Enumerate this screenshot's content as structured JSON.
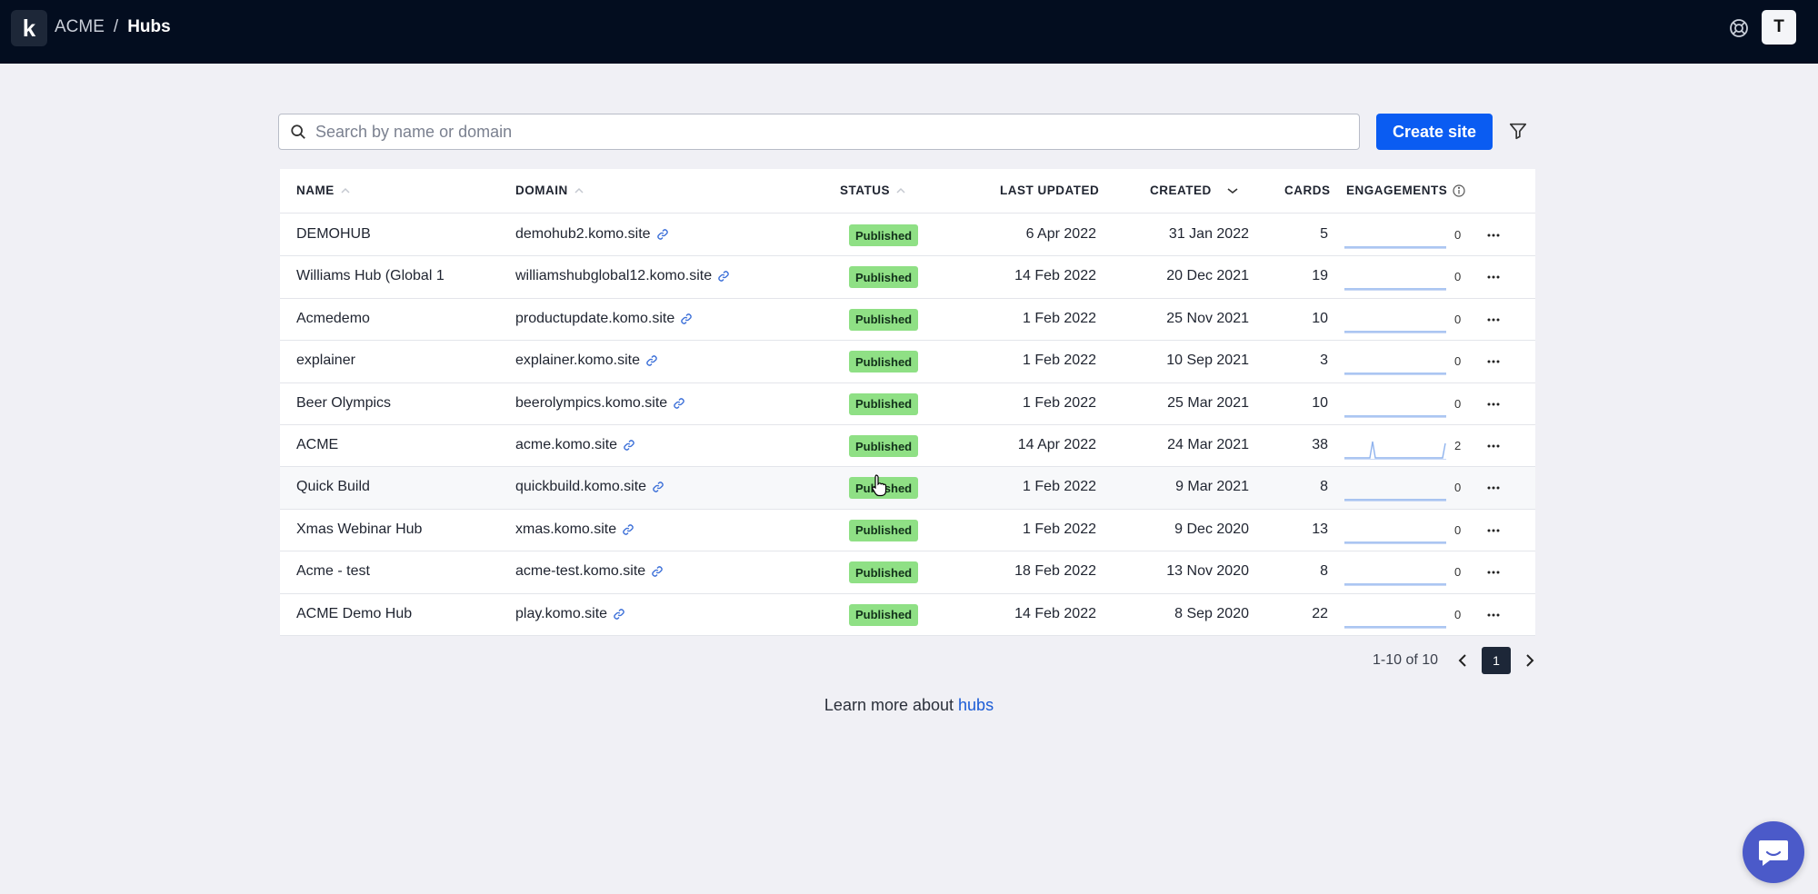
{
  "header": {
    "logo": "k",
    "org": "ACME",
    "separator": "/",
    "page": "Hubs",
    "avatar_initial": "T"
  },
  "search": {
    "placeholder": "Search by name or domain",
    "value": ""
  },
  "toolbar": {
    "create_label": "Create site"
  },
  "table": {
    "columns": [
      "NAME",
      "DOMAIN",
      "STATUS",
      "LAST UPDATED",
      "CREATED",
      "CARDS",
      "ENGAGEMENTS"
    ],
    "rows": [
      {
        "name": "DEMOHUB",
        "domain": "demohub2.komo.site",
        "status": "Published",
        "last_updated": "6 Apr 2022",
        "created": "31 Jan 2022",
        "cards": "5",
        "engagements": "0"
      },
      {
        "name": "Williams Hub (Global 1",
        "domain": "williamshubglobal12.komo.site",
        "status": "Published",
        "last_updated": "14 Feb 2022",
        "created": "20 Dec 2021",
        "cards": "19",
        "engagements": "0"
      },
      {
        "name": "Acmedemo",
        "domain": "productupdate.komo.site",
        "status": "Published",
        "last_updated": "1 Feb 2022",
        "created": "25 Nov 2021",
        "cards": "10",
        "engagements": "0"
      },
      {
        "name": "explainer",
        "domain": "explainer.komo.site",
        "status": "Published",
        "last_updated": "1 Feb 2022",
        "created": "10 Sep 2021",
        "cards": "3",
        "engagements": "0"
      },
      {
        "name": "Beer Olympics",
        "domain": "beerolympics.komo.site",
        "status": "Published",
        "last_updated": "1 Feb 2022",
        "created": "25 Mar 2021",
        "cards": "10",
        "engagements": "0"
      },
      {
        "name": "ACME",
        "domain": "acme.komo.site",
        "status": "Published",
        "last_updated": "14 Apr 2022",
        "created": "24 Mar 2021",
        "cards": "38",
        "engagements": "2"
      },
      {
        "name": "Quick Build",
        "domain": "quickbuild.komo.site",
        "status": "Published",
        "last_updated": "1 Feb 2022",
        "created": "9 Mar 2021",
        "cards": "8",
        "engagements": "0"
      },
      {
        "name": "Xmas Webinar Hub",
        "domain": "xmas.komo.site",
        "status": "Published",
        "last_updated": "1 Feb 2022",
        "created": "9 Dec 2020",
        "cards": "13",
        "engagements": "0"
      },
      {
        "name": "Acme - test",
        "domain": "acme-test.komo.site",
        "status": "Published",
        "last_updated": "18 Feb 2022",
        "created": "13 Nov 2020",
        "cards": "8",
        "engagements": "0"
      },
      {
        "name": "ACME Demo Hub",
        "domain": "play.komo.site",
        "status": "Published",
        "last_updated": "14 Feb 2022",
        "created": "8 Sep 2020",
        "cards": "22",
        "engagements": "0"
      }
    ]
  },
  "pagination": {
    "range": "1-10 of 10",
    "current_page": "1"
  },
  "footer": {
    "learn_prefix": "Learn more about",
    "learn_link": "hubs"
  },
  "colors": {
    "accent": "#0a5cf2",
    "topbar": "#030d1f",
    "badge": "#8fe085",
    "chat": "#4b5ac9"
  },
  "icons": [
    "help-icon",
    "search-icon",
    "filter-icon",
    "sort-arrow-icon",
    "info-icon",
    "link-icon",
    "more-icon",
    "chevron-left-icon",
    "chevron-right-icon",
    "chat-icon"
  ]
}
